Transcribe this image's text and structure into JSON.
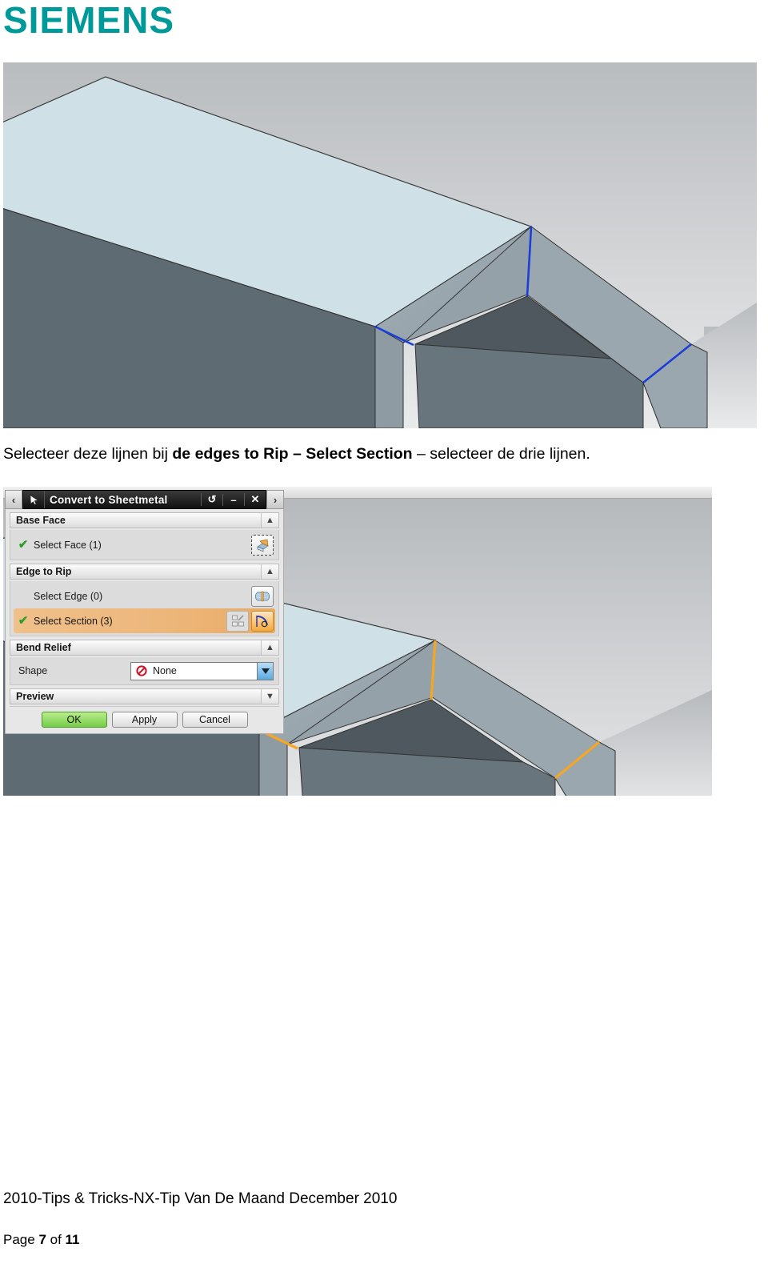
{
  "brand": {
    "logo_text": "SIEMENS",
    "logo_color": "#009999"
  },
  "caption": {
    "part1": "Selecteer deze lijnen bij ",
    "bold": "de edges to Rip – Select Section",
    "part2": " – selecteer de drie lijnen."
  },
  "dialog": {
    "title": "Convert to Sheetmetal",
    "nav_prev": "‹",
    "nav_next": "›",
    "reset_label": "↺",
    "minimize_label": "–",
    "close_label": "✕",
    "groups": [
      {
        "label": "Base Face",
        "collapse_glyph": "▲",
        "rows": [
          {
            "check": "✔",
            "label": "Select Face (1)"
          }
        ]
      },
      {
        "label": "Edge to Rip",
        "collapse_glyph": "▲",
        "rows": [
          {
            "check": "",
            "label": "Select Edge (0)"
          },
          {
            "check": "✔",
            "label": "Select Section (3)"
          }
        ]
      },
      {
        "label": "Bend Relief",
        "collapse_glyph": "▲",
        "shape_label": "Shape",
        "shape_value": "None"
      },
      {
        "label": "Preview",
        "collapse_glyph": "▼"
      }
    ],
    "buttons": {
      "ok": "OK",
      "apply": "Apply",
      "cancel": "Cancel"
    },
    "colors": {
      "highlight": "#edb77c",
      "ok_green": "#76cc49",
      "check_green": "#2aa02a",
      "none_red": "#cc1122"
    }
  },
  "viewport_top": {
    "selected_edge_color": "#1a3fd8",
    "top_face_color": "#cfe0e6",
    "background": "gray-gradient"
  },
  "viewport_bottom": {
    "selected_edge_color": "#f5a623",
    "top_face_color": "#cfe0e6",
    "background": "gray-gradient"
  },
  "footer": {
    "document_line": "2010-Tips & Tricks-NX-Tip Van De Maand December 2010",
    "page_prefix": "Page ",
    "page_number": "7",
    "page_middle": " of ",
    "page_total": "11"
  }
}
